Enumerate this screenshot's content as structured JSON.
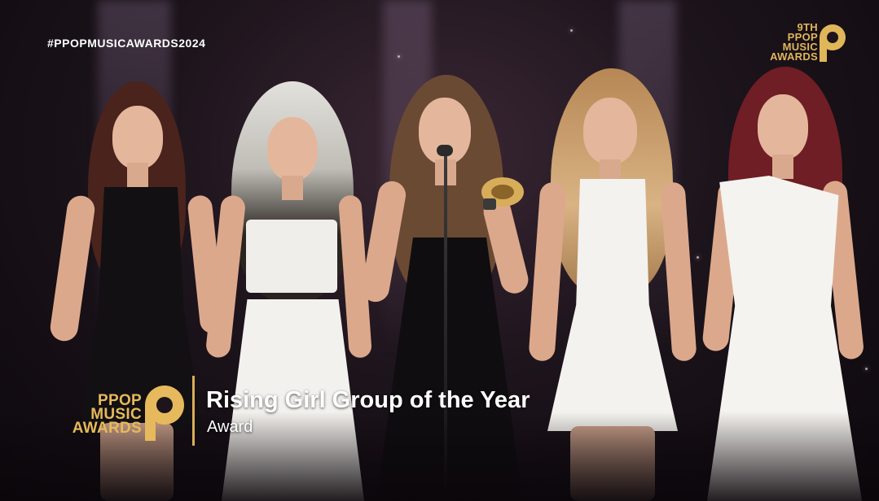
{
  "overlay": {
    "hashtag": "#PPOPMUSICAWARDS2024",
    "corner_logo": {
      "line1": "9TH",
      "line2": "PPOP",
      "line3": "MUSIC",
      "line4": "AWARDS"
    },
    "lower_third": {
      "logo": {
        "line1": "PPOP",
        "line2": "MUSIC",
        "line3": "AWARDS"
      },
      "title": "Rising Girl Group of the Year",
      "subtitle": "Award"
    }
  },
  "colors": {
    "gold": "#e0b65a",
    "text": "#ffffff",
    "background": "#1d141c"
  }
}
